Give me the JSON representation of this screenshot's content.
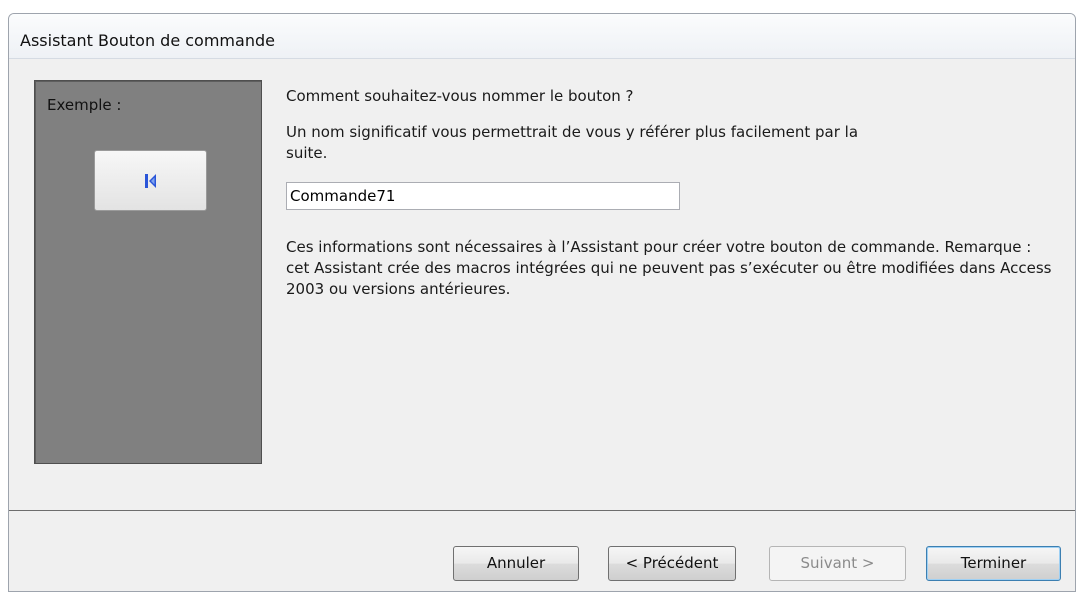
{
  "window": {
    "title": "Assistant Bouton de commande"
  },
  "example": {
    "label": "Exemple :",
    "button_icon": "first-record-icon"
  },
  "form": {
    "question": "Comment souhaitez-vous nommer le bouton ?",
    "hint": "Un nom significatif vous permettrait de vous y référer plus facilement par la suite.",
    "name_value": "Commande71",
    "info": "Ces informations sont nécessaires à l’Assistant pour créer votre bouton de commande. Remarque : cet Assistant crée des macros intégrées qui ne peuvent pas s’exécuter ou être modifiées dans Access 2003 ou versions antérieures."
  },
  "buttons": {
    "cancel": "Annuler",
    "previous": "< Précédent",
    "next": "Suivant >",
    "finish": "Terminer"
  },
  "colors": {
    "accent": "#3c7fb1",
    "icon_blue": "#2a55d8",
    "panel_gray": "#808080"
  }
}
